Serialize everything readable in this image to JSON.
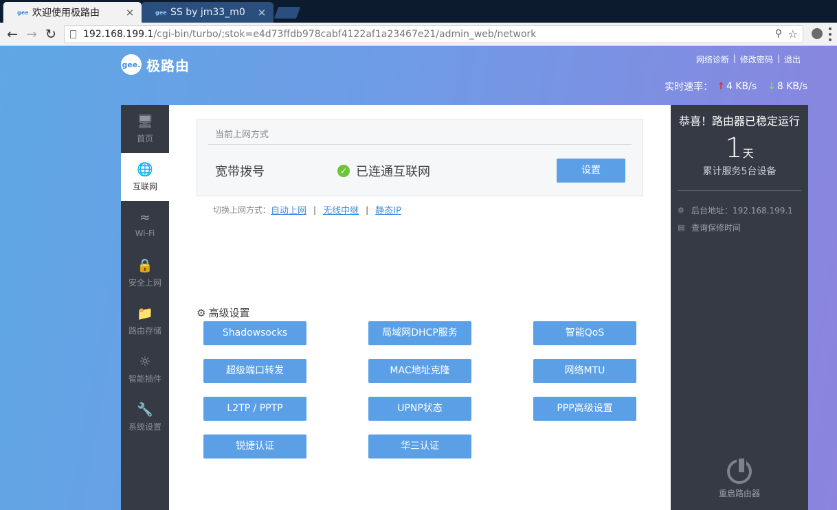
{
  "browser": {
    "tabs": [
      {
        "favicon": "gee",
        "title": "欢迎使用极路由",
        "close": "×",
        "active": true
      },
      {
        "favicon": "gee",
        "title": "SS by jm33_m0",
        "close": "×",
        "active": false
      }
    ],
    "url_host": "192.168.199.1",
    "url_path": "/cgi-bin/turbo/;stok=e4d73ffdb978cabf4122af1a23467e21/admin_web/network",
    "icons": {
      "back": "back-arrow-icon",
      "forward": "forward-arrow-icon",
      "reload": "reload-icon",
      "key": "key-icon",
      "star": "star-icon",
      "menu": "menu-icon"
    }
  },
  "header": {
    "logo_badge": "gee.",
    "brand": "极路由",
    "links": [
      "网络诊断",
      "修改密码",
      "退出"
    ],
    "link_separator": "|",
    "speed_label": "实时速率：",
    "upload": "4 KB/s",
    "download": "8 KB/s",
    "up_arrow": "↑",
    "down_arrow": "↓"
  },
  "sidebar": {
    "items": [
      {
        "label": "首页",
        "icon": "monitor-icon",
        "active": false
      },
      {
        "label": "互联网",
        "icon": "globe-icon",
        "active": true
      },
      {
        "label": "Wi-Fi",
        "icon": "wifi-icon",
        "active": false
      },
      {
        "label": "安全上网",
        "icon": "lock-icon",
        "active": false
      },
      {
        "label": "路由存储",
        "icon": "folder-icon",
        "active": false
      },
      {
        "label": "智能插件",
        "icon": "bulb-icon",
        "active": false
      },
      {
        "label": "系统设置",
        "icon": "wrench-icon",
        "active": false
      }
    ]
  },
  "connection": {
    "heading": "当前上网方式",
    "mode": "宽带拨号",
    "status": "已连通互联网",
    "status_check": "✓",
    "settings_button": "设置"
  },
  "switch": {
    "label": "切换上网方式：",
    "options": [
      "自动上网",
      "无线中继",
      "静态IP"
    ],
    "separator": "|"
  },
  "advanced": {
    "title": "高级设置",
    "buttons": [
      "Shadowsocks",
      "局域网DHCP服务",
      "智能QoS",
      "超级端口转发",
      "MAC地址克隆",
      "网络MTU",
      "L2TP / PPTP",
      "UPNP状态",
      "PPP高级设置",
      "锐捷认证",
      "华三认证"
    ]
  },
  "status_panel": {
    "congrats": "恭喜！路由器已稳定运行",
    "days": "1",
    "days_unit": "天",
    "devices": "累计服务5台设备",
    "backend_address": "后台地址：192.168.199.1",
    "warranty": "查询保修时间",
    "reboot": "重启路由器"
  }
}
